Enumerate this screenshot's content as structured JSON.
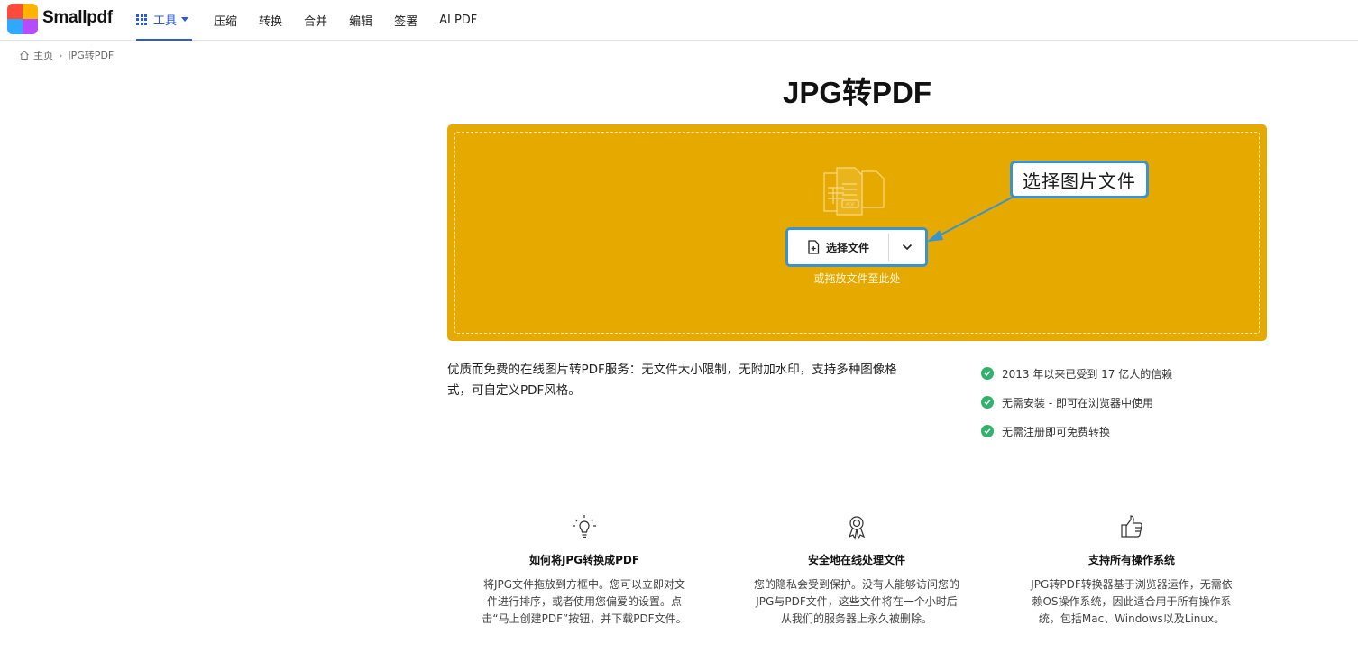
{
  "header": {
    "brand": "Smallpdf",
    "tools_label": "工具",
    "nav": [
      "压缩",
      "转换",
      "合并",
      "编辑",
      "签署",
      "AI PDF"
    ]
  },
  "breadcrumb": {
    "home": "主页",
    "current": "JPG转PDF"
  },
  "page": {
    "title": "JPG转PDF"
  },
  "dropzone": {
    "select_button": "选择文件",
    "hint": "或拖放文件至此处",
    "background_color": "#e5a900"
  },
  "callout": {
    "text": "选择图片文件",
    "color": "#3a93cf"
  },
  "description": "优质而免费的在线图片转PDF服务：无文件大小限制，无附加水印，支持多种图像格式，可自定义PDF风格。",
  "checks": [
    "2013 年以来已受到 17 亿人的信赖",
    "无需安装 - 即可在浏览器中使用",
    "无需注册即可免费转换"
  ],
  "features": [
    {
      "icon": "lightbulb-icon",
      "title": "如何将JPG转换成PDF",
      "text": "将JPG文件拖放到方框中。您可以立即对文件进行排序，或者使用您偏爱的设置。点击“马上创建PDF”按钮，并下载PDF文件。"
    },
    {
      "icon": "award-ribbon-icon",
      "title": "安全地在线处理文件",
      "text": "您的隐私会受到保护。没有人能够访问您的JPG与PDF文件，这些文件将在一个小时后从我们的服务器上永久被删除。"
    },
    {
      "icon": "thumbs-up-icon",
      "title": "支持所有操作系统",
      "text": "JPG转PDF转换器基于浏览器运作，无需依赖OS操作系统，因此适合用于所有操作系统，包括Mac、Windows以及Linux。"
    }
  ]
}
